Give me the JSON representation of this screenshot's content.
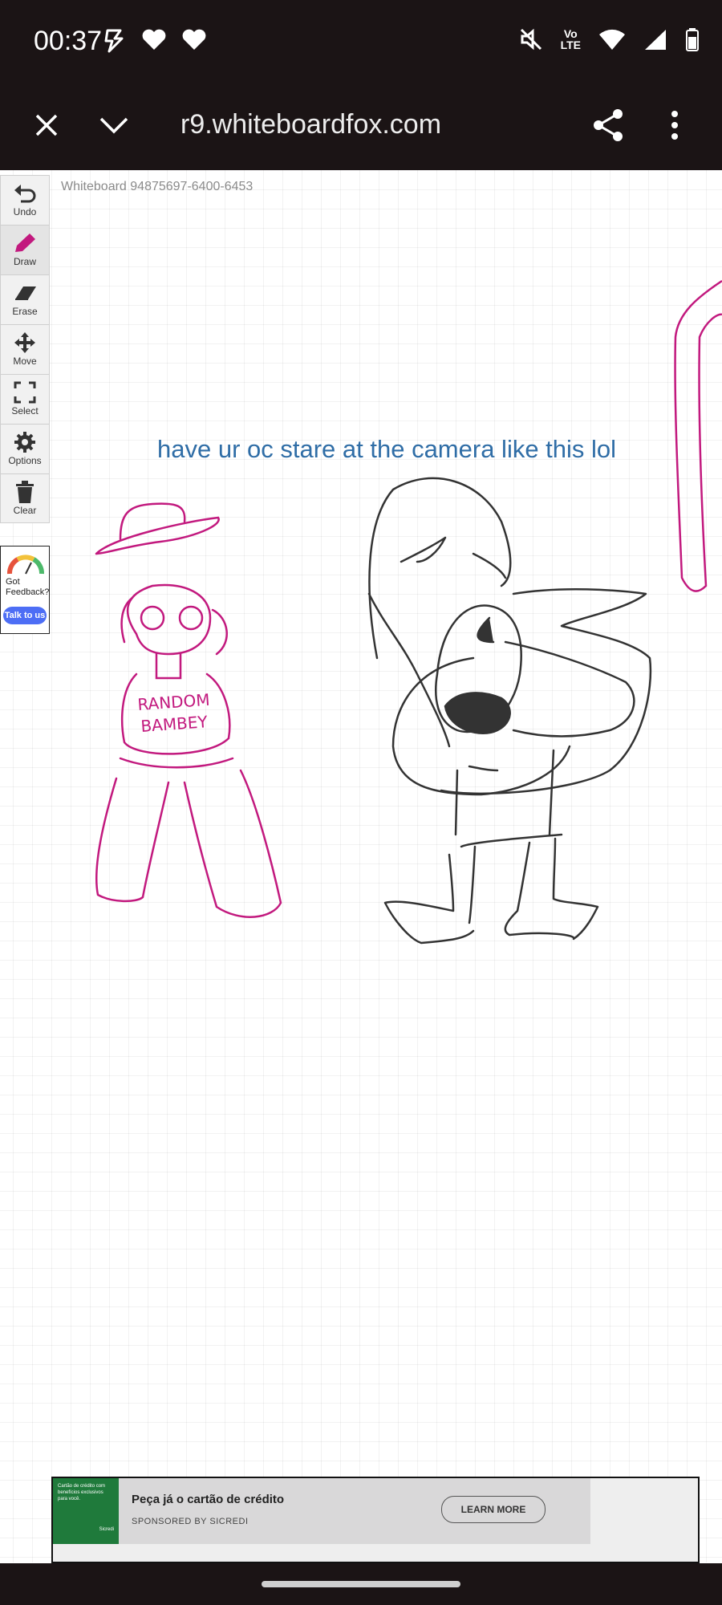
{
  "status_bar": {
    "time": "00:37",
    "left_icons": [
      "bolt-icon",
      "heart-icon",
      "heart-icon"
    ],
    "right_icons": [
      "mute-icon",
      "volte-icon",
      "wifi-icon",
      "signal-icon",
      "battery-icon"
    ],
    "volte_top": "Vo",
    "volte_bottom": "LTE"
  },
  "browser": {
    "url": "r9.whiteboardfox.com"
  },
  "whiteboard": {
    "title": "Whiteboard 94875697-6400-6453",
    "text_annotation": "have ur oc stare at the camera like this lol",
    "sweater_text_line1": "RANDOM",
    "sweater_text_line2": "BAMBEY",
    "ink_colors": {
      "magenta": "#c2197e",
      "dark": "#333333",
      "text_blue": "#2f6da6"
    }
  },
  "toolbar": {
    "undo": "Undo",
    "draw": "Draw",
    "erase": "Erase",
    "move": "Move",
    "select": "Select",
    "options": "Options",
    "clear": "Clear",
    "active_tool": "Draw"
  },
  "feedback": {
    "text": "Got Feedback?",
    "button": "Talk to us"
  },
  "ad": {
    "thumb_text": "Cartão de crédito com benefícios exclusivos para você.",
    "thumb_brand": "Sicredi",
    "headline": "Peça já o cartão de crédito",
    "sponsor": "SPONSORED BY SICREDI",
    "cta": "LEARN MORE"
  }
}
